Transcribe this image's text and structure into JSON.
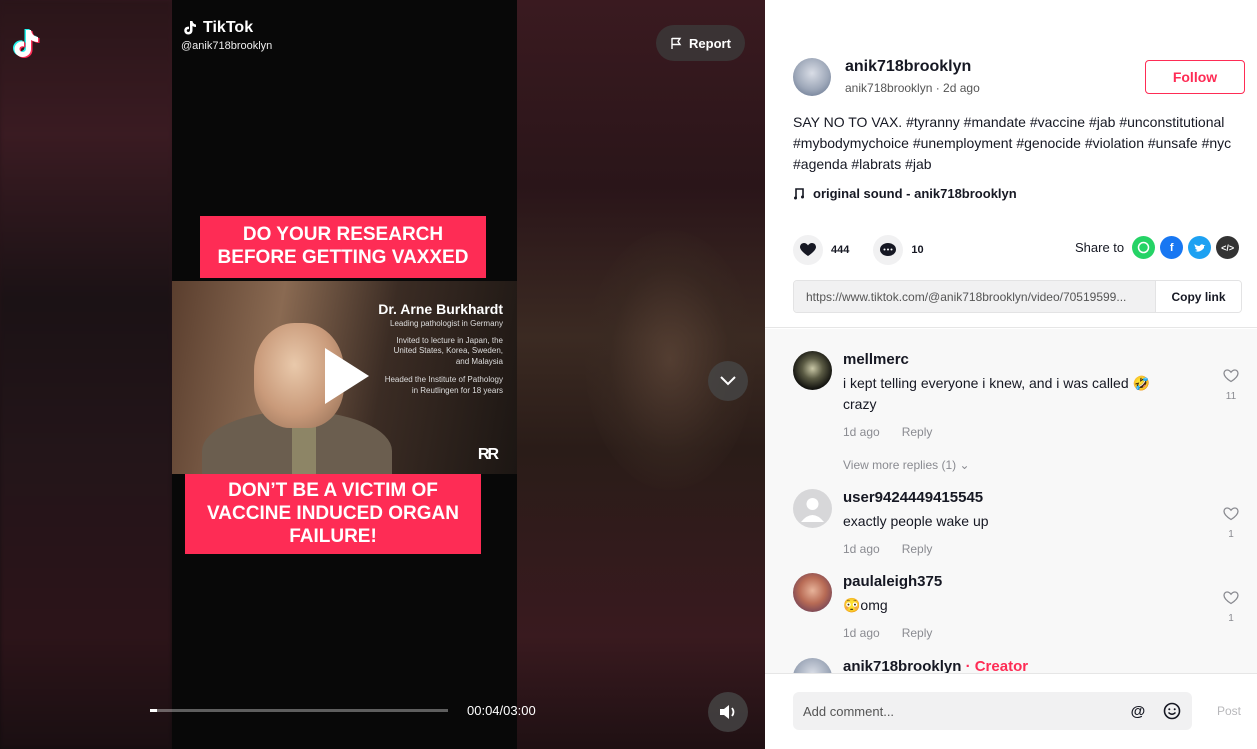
{
  "video": {
    "brand": "TikTok",
    "handle": "@anik718brooklyn",
    "report_label": "Report",
    "caption_top": "DO YOUR RESEARCH BEFORE GETTING VAXXED",
    "caption_bottom": "DON’T BE A VICTIM OF VACCINE INDUCED ORGAN FAILURE!",
    "overlay": {
      "name": "Dr. Arne Burkhardt",
      "subtitle": "Leading pathologist in Germany",
      "line1": "Invited to lecture in Japan, the United States, Korea, Sweden, and Malaysia",
      "line2": "Headed the Institute of Pathology in Reutlingen for 18 years",
      "logo": "RR"
    },
    "time": "00:04/03:00",
    "progress": 0.025
  },
  "post": {
    "author": "anik718brooklyn",
    "meta": "anik718brooklyn · 2d ago",
    "follow_label": "Follow",
    "description": "SAY NO TO VAX. #tyranny #mandate #vaccine #jab #unconstitutional #mybodymychoice #unemployment #genocide #violation #unsafe #nyc #agenda #labrats #jab",
    "sound": "original sound - anik718brooklyn",
    "likes": "444",
    "comments_count": "10",
    "share_label": "Share to",
    "link": "https://www.tiktok.com/@anik718brooklyn/video/70519599...",
    "copy_label": "Copy link"
  },
  "comments": [
    {
      "user": "mellmerc",
      "text": "i kept telling everyone i knew, and i was called 🤣 crazy",
      "date": "1d ago",
      "reply": "Reply",
      "likes": "11",
      "more": "View more replies (1)"
    },
    {
      "user": "user9424449415545",
      "text": "exactly people wake up",
      "date": "1d ago",
      "reply": "Reply",
      "likes": "1"
    },
    {
      "user": "paulaleigh375",
      "text": "😳omg",
      "date": "1d ago",
      "reply": "Reply",
      "likes": "1"
    },
    {
      "user": "anik718brooklyn",
      "tag": "· Creator"
    }
  ],
  "comment_bar": {
    "placeholder": "Add comment...",
    "post_label": "Post"
  }
}
